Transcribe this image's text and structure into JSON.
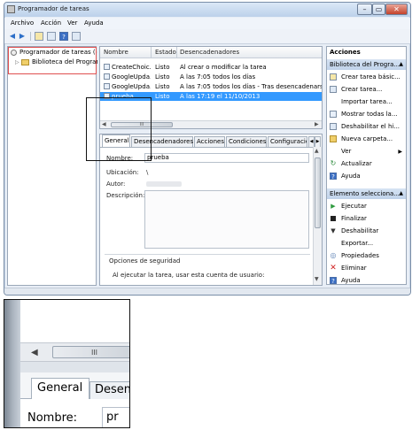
{
  "window": {
    "title": "Programador de tareas",
    "controls": {
      "minimize": "–",
      "maximize": "▭",
      "close": "✕"
    }
  },
  "menu": [
    "Archivo",
    "Acción",
    "Ver",
    "Ayuda"
  ],
  "tree": {
    "root": "Programador de tareas (lo",
    "child": "Biblioteca del Program"
  },
  "task_list": {
    "columns": [
      "Nombre",
      "Estado",
      "Desencadenadores"
    ],
    "rows": [
      {
        "name": "CreateChoic...",
        "status": "Listo",
        "trigger": "Al crear o modificar la tarea"
      },
      {
        "name": "GoogleUpda...",
        "status": "Listo",
        "trigger": "A las 7:05 todos los días"
      },
      {
        "name": "GoogleUpda...",
        "status": "Listo",
        "trigger": "A las 7:05 todos los días - Tras desencadenarse, repetir"
      },
      {
        "name": "prueba",
        "status": "Listo",
        "trigger": "A las 17:19 el 11/10/2013"
      }
    ],
    "scroll_glyph": "III"
  },
  "details": {
    "tabs": [
      "General",
      "Desencadenadores",
      "Acciones",
      "Condiciones",
      "Configuració"
    ],
    "fields": {
      "name_label": "Nombre:",
      "name_value": "prueba",
      "location_label": "Ubicación:",
      "location_value": "\\",
      "author_label": "Autor:",
      "description_label": "Descripción:"
    },
    "security_header": "Opciones de seguridad",
    "security_text": "Al ejecutar la tarea, usar esta cuenta de usuario:"
  },
  "actions_pane": {
    "header": "Acciones",
    "section1_title": "Biblioteca del Progra...",
    "section1_items": [
      "Crear tarea básic...",
      "Crear tarea...",
      "Importar tarea...",
      "Mostrar todas la...",
      "Deshabilitar el hi...",
      "Nueva carpeta...",
      "Ver",
      "Actualizar",
      "Ayuda"
    ],
    "section2_title": "Elemento selecciona...",
    "section2_items": [
      "Ejecutar",
      "Finalizar",
      "Deshabilitar",
      "Exportar...",
      "Propiedades",
      "Eliminar",
      "Ayuda"
    ]
  },
  "zoom": {
    "scroll_glyph": "III",
    "tab_active": "General",
    "tab_next": "Desen",
    "name_label": "Nombre:",
    "name_value": "pr"
  },
  "colors": {
    "selection": "#3399ff",
    "highlight_red": "#e05050",
    "title_gradient_top": "#dbe8f7"
  }
}
